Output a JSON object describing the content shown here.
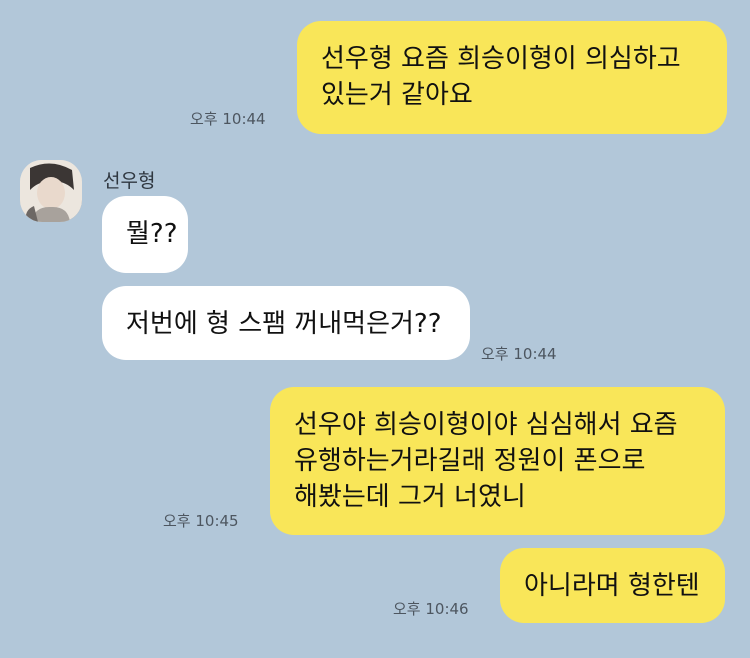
{
  "colors": {
    "background": "#b2c7d9",
    "my_bubble": "#f9e659",
    "other_bubble": "#ffffff",
    "timestamp": "#4d5660"
  },
  "contact": {
    "name": "선우형",
    "avatar_icon": "profile-photo"
  },
  "messages": [
    {
      "from": "me",
      "text": "선우형 요즘 희승이형이 의심하고\n있는거 같아요",
      "time": "오후 10:44"
    },
    {
      "from": "other",
      "text": "뭘??",
      "time": ""
    },
    {
      "from": "other",
      "text": "저번에 형 스팸 꺼내먹은거??",
      "time": "오후 10:44"
    },
    {
      "from": "me",
      "text": "선우야 희승이형이야 심심해서 요즘\n유행하는거라길래 정원이 폰으로\n해봤는데 그거 너였니",
      "time": "오후 10:45"
    },
    {
      "from": "me",
      "text": "아니라며 형한텐",
      "time": "오후 10:46"
    }
  ]
}
